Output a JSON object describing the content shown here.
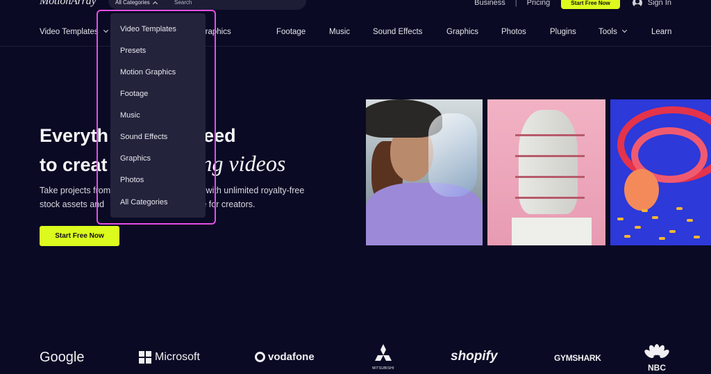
{
  "header": {
    "logo": "MotionArray",
    "category_select": "All Categories",
    "search_placeholder": "Search",
    "business": "Business",
    "separator": "|",
    "pricing": "Pricing",
    "start_free": "Start Free Now",
    "sign_in": "Sign In"
  },
  "nav": {
    "items": [
      {
        "label": "Video Templates",
        "has_chevron": true
      },
      {
        "label": "Motion Graphics"
      },
      {
        "label": "Footage"
      },
      {
        "label": "Music"
      },
      {
        "label": "Sound Effects"
      },
      {
        "label": "Graphics"
      },
      {
        "label": "Photos"
      },
      {
        "label": "Plugins"
      },
      {
        "label": "Tools",
        "has_chevron": true
      },
      {
        "label": "Learn"
      }
    ]
  },
  "dropdown": {
    "items": [
      "Video Templates",
      "Presets",
      "Motion Graphics",
      "Footage",
      "Music",
      "Sound Effects",
      "Graphics",
      "Photos",
      "All Categories"
    ]
  },
  "hero": {
    "title_line1": "Everyth",
    "title_line1_end": "eed",
    "title_line2": "to creat",
    "title_line2_italic": "ng videos",
    "sub_line1_a": "Take projects from",
    "sub_line1_b": "n with unlimited royalty-free",
    "sub_line2_a": "stock assets and",
    "sub_line2_b": "ce for creators.",
    "cta": "Start Free Now"
  },
  "logos": {
    "google": "Google",
    "microsoft": "Microsoft",
    "vodafone": "vodafone",
    "mitsubishi": "MITSUBISHI",
    "shopify": "shopify",
    "gymshark": "GYMSHARK",
    "nbc": "NBC"
  },
  "colors": {
    "background": "#0a0a24",
    "accent": "#dcfa1e",
    "dropdown_bg": "#23233c",
    "highlight": "#e44fe6"
  }
}
